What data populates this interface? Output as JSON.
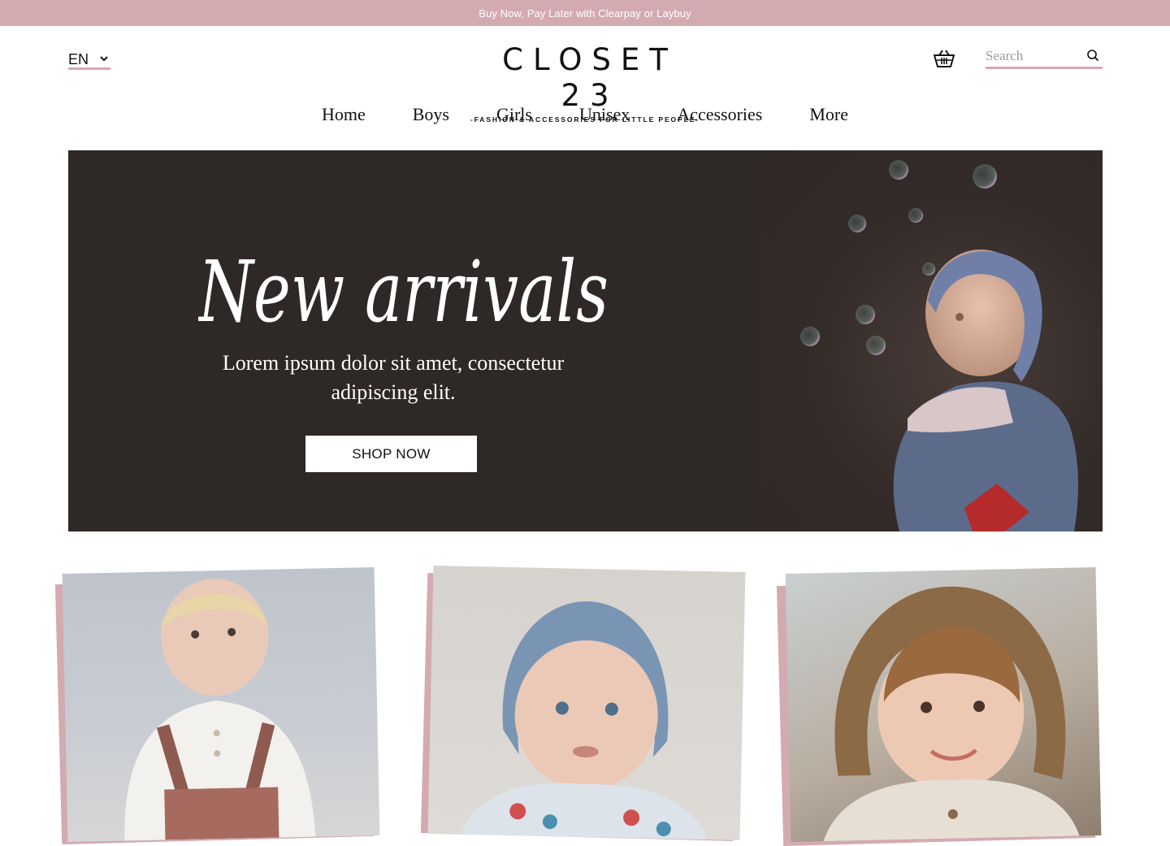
{
  "promo_bar": {
    "text": "Buy Now, Pay Later with Clearpay or Laybuy"
  },
  "language": {
    "selected": "EN"
  },
  "logo": {
    "brand": "CLOSET 23",
    "tagline": "-FASHION & ACCESSORIES FOR LITTLE PEOPLE-"
  },
  "search": {
    "placeholder": "Search"
  },
  "nav": {
    "items": [
      {
        "label": "Home",
        "active": true
      },
      {
        "label": "Boys"
      },
      {
        "label": "Girls"
      },
      {
        "label": "Unisex"
      },
      {
        "label": "Accessories"
      },
      {
        "label": "More"
      }
    ]
  },
  "hero": {
    "script_title": "New arrivals",
    "subtitle_line1": "Lorem ipsum dolor sit amet, consectetur",
    "subtitle_line2": "adipiscing elit.",
    "cta_label": "SHOP NOW"
  },
  "colors": {
    "accent": "#d4aab1",
    "hero_bg": "#2e2826"
  },
  "icons": {
    "cart": "basket-icon",
    "search": "search-icon",
    "language": "chevron-down-icon"
  }
}
